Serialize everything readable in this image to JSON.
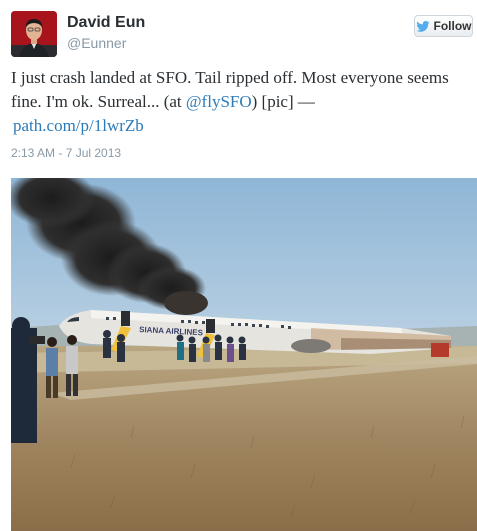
{
  "author": {
    "name": "David Eun",
    "handle": "@Eunner"
  },
  "follow_button": {
    "label": "Follow",
    "icon": "twitter-bird-icon"
  },
  "tweet": {
    "text_before_mention": "I just crash landed at SFO. Tail ripped off. Most everyone seems fine. I'm ok. Surreal... (at ",
    "mention": "@flySFO",
    "text_after_mention": ") [pic] — ",
    "link": "path.com/p/1lwrZb",
    "timestamp": "2:13 AM - 7 Jul 2013"
  },
  "photo": {
    "airline_text": "SIANA AIRLINES"
  },
  "colors": {
    "link": "#2b7bb9",
    "handle": "#8899a6"
  }
}
